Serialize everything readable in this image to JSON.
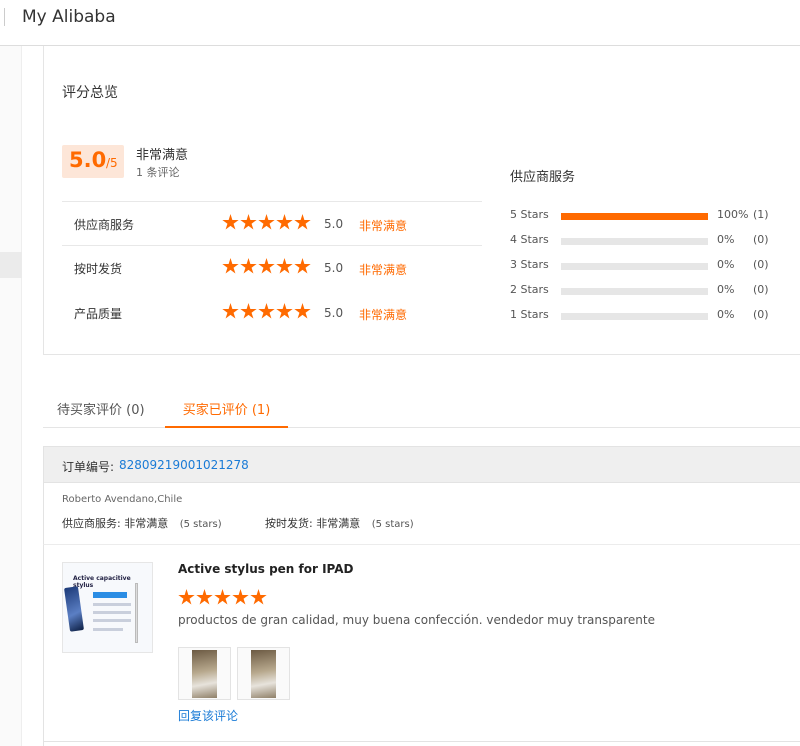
{
  "header": {
    "title": "My Alibaba"
  },
  "overview": {
    "title": "评分总览",
    "score": "5.0",
    "score_denominator": "/5",
    "score_label": "非常满意",
    "review_count": "1 条评论",
    "criteria": [
      {
        "name": "供应商服务",
        "stars": 5,
        "value": "5.0",
        "word": "非常满意"
      },
      {
        "name": "按时发货",
        "stars": 5,
        "value": "5.0",
        "word": "非常满意"
      },
      {
        "name": "产品质量",
        "stars": 5,
        "value": "5.0",
        "word": "非常满意"
      }
    ],
    "distribution_title": "供应商服务",
    "distribution": [
      {
        "label": "5 Stars",
        "fraction": 1.0,
        "percent": "100%",
        "count": "(1)"
      },
      {
        "label": "4 Stars",
        "fraction": 0.0,
        "percent": "0%",
        "count": "(0)"
      },
      {
        "label": "3 Stars",
        "fraction": 0.0,
        "percent": "0%",
        "count": "(0)"
      },
      {
        "label": "2 Stars",
        "fraction": 0.0,
        "percent": "0%",
        "count": "(0)"
      },
      {
        "label": "1 Stars",
        "fraction": 0.0,
        "percent": "0%",
        "count": "(0)"
      }
    ],
    "accent_color": "#ff6a00"
  },
  "tabs": [
    {
      "label": "待买家评价 (0)",
      "active": false
    },
    {
      "label": "买家已评价 (1)",
      "active": true
    }
  ],
  "order": {
    "label": "订单编号:",
    "number": "82809219001021278"
  },
  "review": {
    "reviewer": "Roberto Avendano,Chile",
    "supplier_service_label": "供应商服务:",
    "supplier_service_value": "非常满意",
    "supplier_service_note": "(5 stars)",
    "on_time_label": "按时发货:",
    "on_time_value": "非常满意",
    "on_time_note": "(5 stars)",
    "product_title": "Active stylus pen for IPAD",
    "product_stars": 5,
    "thumbnail_heading": "Active capacitive stylus",
    "comment": "productos de gran calidad, muy buena confección.  vendedor muy transparente",
    "photo_count": 2,
    "reply_link": "回复该评论"
  }
}
